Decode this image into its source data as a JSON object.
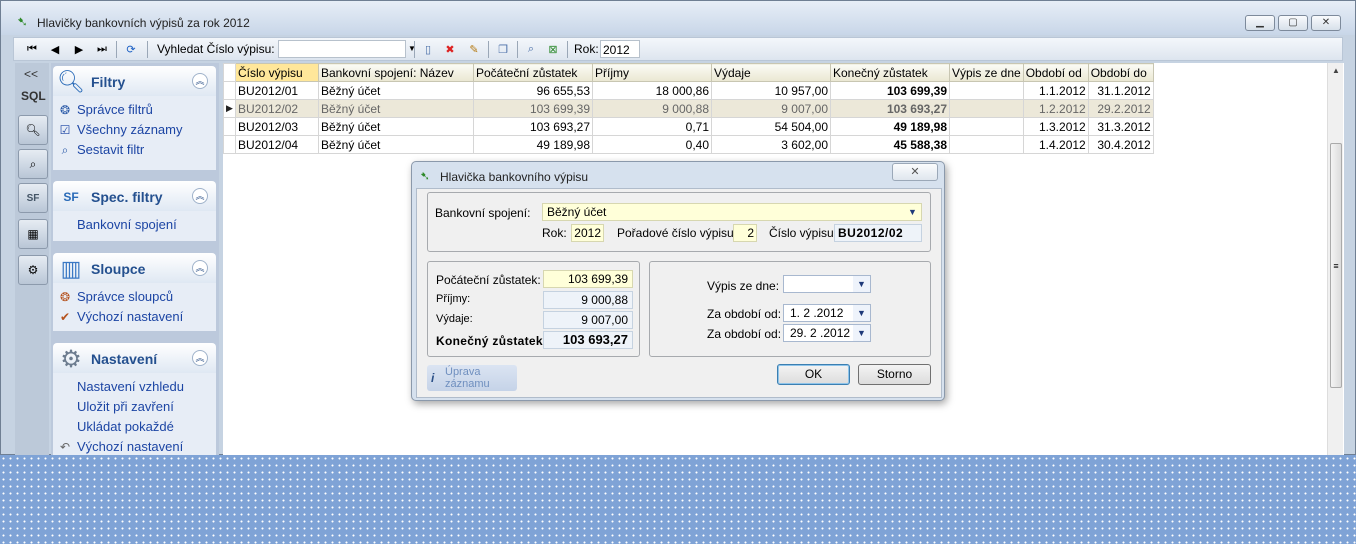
{
  "window": {
    "title": "Hlavičky bankovních výpisů za rok 2012",
    "min_icon": "minimize-icon",
    "max_icon": "maximize-icon",
    "close_icon": "close-icon"
  },
  "toolbar": {
    "search_label": "Vyhledat Číslo výpisu:",
    "search_value": "",
    "year_label": "Rok:",
    "year_value": "2012"
  },
  "leftstrip": {
    "collapse": "<<",
    "sql": "SQL"
  },
  "groups": {
    "filtry": {
      "title": "Filtry",
      "items": [
        "Správce filtrů",
        "Všechny záznamy",
        "Sestavit filtr"
      ]
    },
    "spec": {
      "title": "Spec. filtry",
      "items": [
        "Bankovní spojení"
      ]
    },
    "sloupce": {
      "title": "Sloupce",
      "items": [
        "Správce sloupců",
        "Výchozí nastavení"
      ]
    },
    "nastaveni": {
      "title": "Nastavení",
      "items": [
        "Nastavení vzhledu",
        "Uložit při zavření",
        "Ukládat pokaždé",
        "Výchozí nastavení"
      ]
    }
  },
  "table": {
    "headers": [
      "Číslo výpisu",
      "Bankovní spojení: Název",
      "Počáteční zůstatek",
      "Příjmy",
      "Výdaje",
      "Konečný zůstatek",
      "Výpis ze dne",
      "Období od",
      "Období do"
    ],
    "rows": [
      [
        "BU2012/01",
        "Běžný účet",
        "96 655,53",
        "18 000,86",
        "10 957,00",
        "103 699,39",
        "",
        "1.1.2012",
        "31.1.2012"
      ],
      [
        "BU2012/02",
        "Běžný účet",
        "103 699,39",
        "9 000,88",
        "9 007,00",
        "103 693,27",
        "",
        "1.2.2012",
        "29.2.2012"
      ],
      [
        "BU2012/03",
        "Běžný účet",
        "103 693,27",
        "0,71",
        "54 504,00",
        "49 189,98",
        "",
        "1.3.2012",
        "31.3.2012"
      ],
      [
        "BU2012/04",
        "Běžný účet",
        "49 189,98",
        "0,40",
        "3 602,00",
        "45 588,38",
        "",
        "1.4.2012",
        "30.4.2012"
      ]
    ],
    "selected_row": 1
  },
  "dialog": {
    "title": "Hlavička bankovního výpisu",
    "bank_label": "Bankovní spojení:",
    "bank_value": "Běžný účet",
    "year_label": "Rok:",
    "year_value": "2012",
    "order_label": "Pořadové číslo výpisu:",
    "order_value": "2",
    "number_label": "Číslo výpisu:",
    "number_value": "BU2012/02",
    "start_label": "Počáteční zůstatek:",
    "start_value": "103 699,39",
    "income_label": "Příjmy:",
    "income_value": "9 000,88",
    "expense_label": "Výdaje:",
    "expense_value": "9 007,00",
    "end_label": "Konečný zůstatek:",
    "end_value": "103 693,27",
    "date_label": "Výpis ze dne:",
    "date_value": "",
    "from_label": "Za období od:",
    "from_value": "1. 2 .2012",
    "to_label": "Za období od:",
    "to_value": "29. 2 .2012",
    "ok": "OK",
    "cancel": "Storno",
    "hint_line1": "Úprava",
    "hint_line2": "záznamu"
  },
  "colors": {
    "accent": "#24508f",
    "link": "#1c45a4",
    "highlight_field": "#ffffd9"
  }
}
